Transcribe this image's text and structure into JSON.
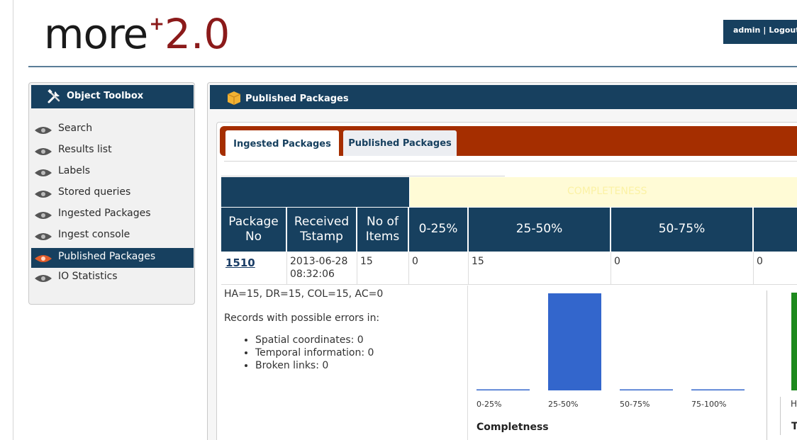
{
  "app": {
    "logo_word": "more",
    "logo_plus": "+",
    "logo_version": "2.0"
  },
  "userbar": {
    "user": "admin",
    "separator": "|",
    "logout": "Logout"
  },
  "sidebar": {
    "title": "Object Toolbox",
    "items": [
      {
        "label": "Search",
        "active": false
      },
      {
        "label": "Results list",
        "active": false
      },
      {
        "label": "Labels",
        "active": false
      },
      {
        "label": "Stored queries",
        "active": false
      },
      {
        "label": "Ingested Packages",
        "active": false
      },
      {
        "label": "Ingest console",
        "active": false
      },
      {
        "label": "Published Packages",
        "active": true
      },
      {
        "label": "IO Statistics",
        "active": false
      }
    ]
  },
  "main": {
    "title": "Published Packages",
    "tabs": [
      {
        "label": "Ingested Packages",
        "selected": true
      },
      {
        "label": "Published Packages",
        "selected": false
      }
    ],
    "band_text": "COMPLETENESS",
    "table": {
      "headers": {
        "package_no": [
          "Package",
          "No"
        ],
        "received": [
          "Received",
          "Tstamp"
        ],
        "items": [
          "No of",
          "Items"
        ],
        "c1": "0-25%",
        "c2": "25-50%",
        "c3": "50-75%"
      },
      "row": {
        "package_no": "1510",
        "date": "2013-06-28",
        "time": "08:32:06",
        "items": "15",
        "c1": "0",
        "c2": "15",
        "c3": "0",
        "c4": "0"
      }
    },
    "detail": {
      "summary": "HA=15, DR=15, COL=15, AC=0",
      "errors_intro": "Records with possible errors in:",
      "errors": [
        "Spatial coordinates: 0",
        "Temporal information: 0",
        "Broken links: 0"
      ]
    },
    "side_chart": {
      "label_fragment": "H",
      "title_fragment": "T"
    }
  },
  "chart_data": {
    "type": "bar",
    "title": "Completness",
    "categories": [
      "0-25%",
      "25-50%",
      "50-75%",
      "75-100%"
    ],
    "values": [
      0,
      15,
      0,
      0
    ],
    "ylim": [
      0,
      15
    ],
    "bar_color": "#3366cc",
    "grid": false
  },
  "colors": {
    "navy": "#17405f",
    "brand_red": "#8b1a1a",
    "tab_bar": "#a52e00",
    "band_light": "#fffbd6",
    "green": "#1d8a1d"
  }
}
